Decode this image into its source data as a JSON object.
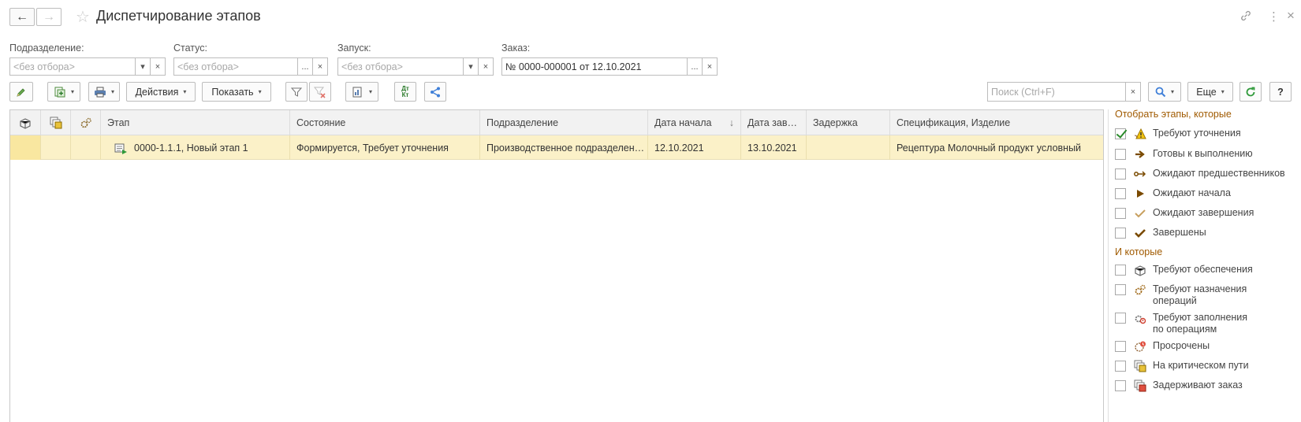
{
  "window": {
    "title": "Диспетчирование этапов",
    "back_icon": "←",
    "forward_icon": "→",
    "star_icon": "☆",
    "link_icon": "🔗",
    "more_icon": "⋮",
    "close_icon": "×"
  },
  "filters": {
    "department": {
      "label": "Подразделение:",
      "placeholder": "<без отбора>"
    },
    "status": {
      "label": "Статус:",
      "placeholder": "<без отбора>"
    },
    "launch": {
      "label": "Запуск:",
      "placeholder": "<без отбора>"
    },
    "order": {
      "label": "Заказ:",
      "value": "№ 0000-000001 от 12.10.2021"
    },
    "ellipsis": "...",
    "clear": "×",
    "dropdown": "▾"
  },
  "toolbar": {
    "actions_label": "Действия",
    "show_label": "Показать",
    "search_placeholder": "Поиск (Ctrl+F)",
    "more_label": "Еще",
    "help_label": "?",
    "caret": "▾",
    "dtkt_label": "Дт Кт"
  },
  "table": {
    "columns": {
      "etap": "Этап",
      "state": "Состояние",
      "department": "Подразделение",
      "start_date": "Дата начала",
      "end_date": "Дата зав…",
      "delay": "Задержка",
      "spec": "Спецификация, Изделие"
    },
    "sort_icon": "↓",
    "rows": [
      {
        "etap": "0000-1.1.1, Новый этап 1",
        "state": "Формируется, Требует уточнения",
        "department": "Производственное подразделен…",
        "start_date": "12.10.2021",
        "end_date": "13.10.2021",
        "delay": "",
        "spec": "Рецептура  Молочный продукт условный"
      }
    ]
  },
  "panel": {
    "title1": "Отобрать этапы, которые",
    "items1": [
      {
        "label": "Требуют уточнения",
        "checked": true,
        "icon": "warning-hand-icon"
      },
      {
        "label": "Готовы к выполнению",
        "checked": false,
        "icon": "arrow-right-icon"
      },
      {
        "label": "Ожидают предшественников",
        "checked": false,
        "icon": "chain-icon"
      },
      {
        "label": "Ожидают начала",
        "checked": false,
        "icon": "play-icon"
      },
      {
        "label": "Ожидают завершения",
        "checked": false,
        "icon": "check-outline-icon"
      },
      {
        "label": "Завершены",
        "checked": false,
        "icon": "check-icon"
      }
    ],
    "title2": "И которые",
    "items2": [
      {
        "label": "Требуют обеспечения",
        "checked": false,
        "icon": "supply-icon"
      },
      {
        "label": "Требуют назначения\nопераций",
        "checked": false,
        "icon": "gear-assign-icon"
      },
      {
        "label": "Требуют заполнения\nпо операциям",
        "checked": false,
        "icon": "gear-fill-icon"
      },
      {
        "label": "Просрочены",
        "checked": false,
        "icon": "overdue-icon"
      },
      {
        "label": "На критическом пути",
        "checked": false,
        "icon": "critical-path-icon"
      },
      {
        "label": "Задерживают заказ",
        "checked": false,
        "icon": "delay-order-icon"
      }
    ]
  },
  "colors": {
    "row_highlight": "#fbf1c8",
    "panel_heading": "#a05a00",
    "checkbox_check": "#2a8a2a"
  }
}
